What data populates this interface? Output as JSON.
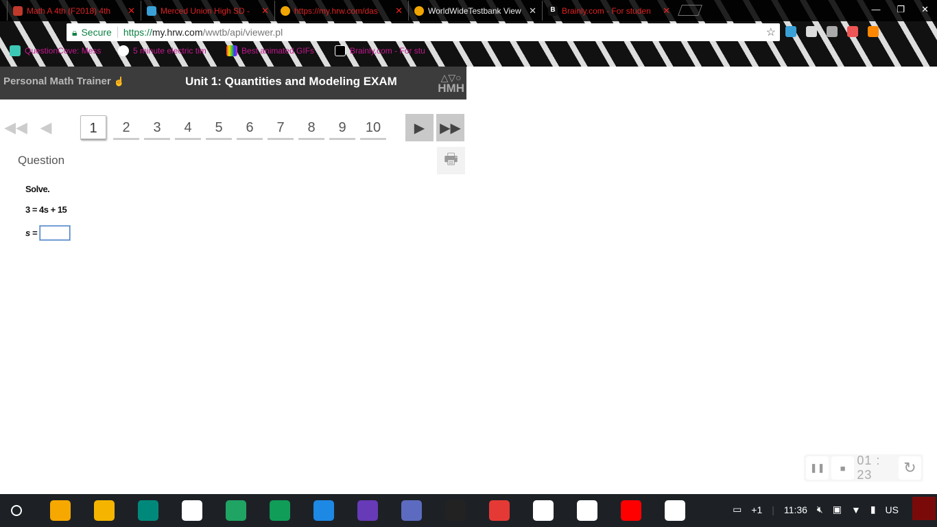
{
  "browser": {
    "tabs": [
      {
        "title": "Math A 4th (F2018) 4th",
        "color": "#c0392b",
        "active": false
      },
      {
        "title": "Merced Union High SD -",
        "color": "#3aa0d8",
        "active": false
      },
      {
        "title": "https://my.hrw.com/das",
        "color": "#f0a500",
        "active": false
      },
      {
        "title": "WorldWideTestbank View",
        "color": "#f0a500",
        "active": true
      },
      {
        "title": "Brainly.com - For studen",
        "color": "#111",
        "active": false
      }
    ],
    "secure_label": "Secure",
    "url_scheme": "https://",
    "url_host": "my.hrw.com",
    "url_path": "/wwtb/api/viewer.pl",
    "bookmarks": [
      {
        "label": "QuestionCove: Mess",
        "color": "#3cc8b4"
      },
      {
        "label": "5 minute electric tim",
        "color": "#fff"
      },
      {
        "label": "Best animated GIFs",
        "color": "#b5d"
      },
      {
        "label": "Brainly.com - For stu",
        "color": "#000"
      }
    ]
  },
  "header": {
    "app_name": "Personal Math Trainer",
    "title": "Unit 1: Quantities and Modeling EXAM",
    "logo": "HMH"
  },
  "pager": {
    "pages": [
      "1",
      "2",
      "3",
      "4",
      "5",
      "6",
      "7",
      "8",
      "9",
      "10"
    ],
    "current": "1"
  },
  "question": {
    "label": "Question",
    "instruction": "Solve.",
    "equation": "3 = 4s + 15",
    "answer_label": "s =",
    "answer_value": ""
  },
  "recorder": {
    "time": "01 : 23"
  },
  "shelf": {
    "apps": [
      "#f6a800",
      "#f4b400",
      "#00897b",
      "#ffffff",
      "#1fa463",
      "#0f9d58",
      "#1e88e5",
      "#673ab7",
      "#5c6bc0",
      "#222",
      "#e53935",
      "#ffffff",
      "#ffffff",
      "#ff0000",
      "#ffffff"
    ],
    "notifications": "+1",
    "clock": "11:36",
    "locale": "US"
  }
}
